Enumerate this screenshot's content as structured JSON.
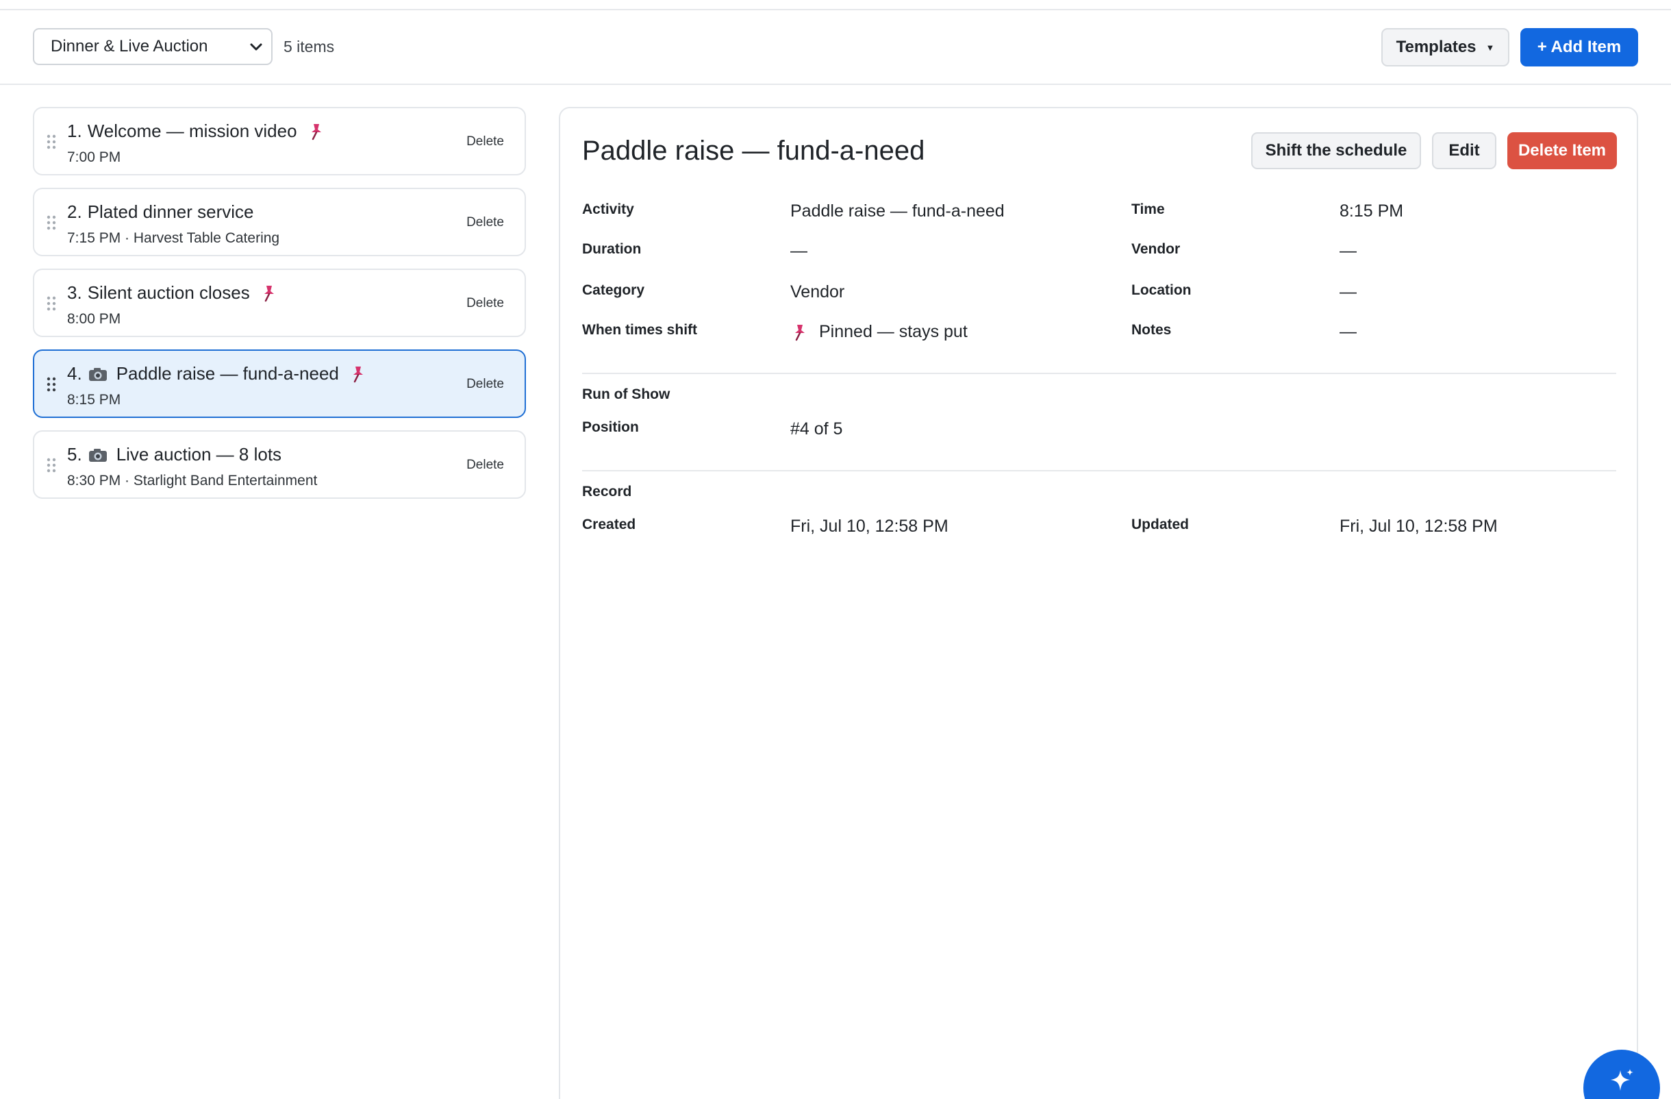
{
  "toolbar": {
    "event_selected": "Dinner & Live Auction",
    "item_count": "5 items",
    "templates_label": "Templates",
    "add_item_label": "+ Add Item"
  },
  "items": [
    {
      "number": "1.",
      "title": "Welcome — mission video",
      "pinned": true,
      "camera": false,
      "subtitle": "7:00 PM",
      "delete_label": "Delete"
    },
    {
      "number": "2.",
      "title": "Plated dinner service",
      "pinned": false,
      "camera": false,
      "subtitle": "7:15 PM · Harvest Table Catering",
      "delete_label": "Delete"
    },
    {
      "number": "3.",
      "title": "Silent auction closes",
      "pinned": true,
      "camera": false,
      "subtitle": "8:00 PM",
      "delete_label": "Delete"
    },
    {
      "number": "4.",
      "title": "Paddle raise — fund-a-need",
      "pinned": true,
      "camera": true,
      "subtitle": "8:15 PM",
      "delete_label": "Delete",
      "selected": true
    },
    {
      "number": "5.",
      "title": "Live auction — 8 lots",
      "pinned": false,
      "camera": true,
      "subtitle": "8:30 PM · Starlight Band Entertainment",
      "delete_label": "Delete"
    }
  ],
  "detail": {
    "title": "Paddle raise — fund-a-need",
    "shift_label": "Shift the schedule",
    "edit_label": "Edit",
    "delete_label": "Delete Item",
    "fields": {
      "activity_label": "Activity",
      "activity_value": "Paddle raise — fund-a-need",
      "time_label": "Time",
      "time_value": "8:15 PM",
      "duration_label": "Duration",
      "duration_value": "—",
      "vendor_label": "Vendor",
      "vendor_value": "—",
      "category_label": "Category",
      "category_value": "Vendor",
      "location_label": "Location",
      "location_value": "—",
      "shift_label": "When times shift",
      "shift_value": "Pinned — stays put",
      "notes_label": "Notes",
      "notes_value": "—"
    },
    "run_of_show": {
      "heading": "Run of Show",
      "position_label": "Position",
      "position_value": "#4 of 5"
    },
    "record": {
      "heading": "Record",
      "created_label": "Created",
      "created_value": "Fri, Jul 10, 12:58 PM",
      "updated_label": "Updated",
      "updated_value": "Fri, Jul 10, 12:58 PM"
    }
  },
  "colors": {
    "primary": "#1268e0",
    "danger": "#dc5242",
    "selected_bg": "#e6f1fc",
    "selected_border": "#1f6fd4",
    "pin": "#d6336c"
  },
  "icons": {
    "pin": "pushpin-icon",
    "camera": "camera-icon",
    "grip": "drag-handle-icon",
    "chevron": "chevron-down-icon",
    "assistant": "sparkle-icon"
  }
}
